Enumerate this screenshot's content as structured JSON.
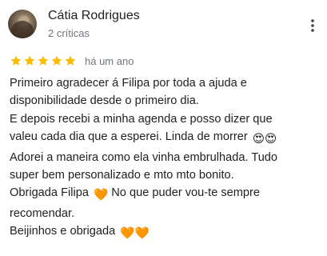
{
  "review": {
    "author": {
      "name": "Cátia Rodrigues",
      "review_count": "2 críticas",
      "avatar_icon": "profile-photo"
    },
    "rating": 5,
    "rating_max": 5,
    "star_color": "#fbbc04",
    "time_ago": "há um ano",
    "more_icon": "more-vert-icon",
    "text_lines": [
      "Primeiro agradecer á Filipa por toda a ajuda e",
      "disponibilidade desde o primeiro dia.",
      "E depois recebi a minha agenda e posso dizer que",
      "valeu cada dia que a esperei. Linda de morrer",
      "Adorei a maneira como ela vinha embrulhada. Tudo",
      "super bem personalizado e mto mto bonito.",
      "Obrigada Filipa",
      " No que puder vou-te sempre",
      "recomendar.",
      "Beijinhos e obrigada"
    ],
    "emojis": {
      "heart_eyes": "😍😍",
      "orange_heart": "🧡",
      "orange_hearts": "🧡🧡"
    }
  }
}
